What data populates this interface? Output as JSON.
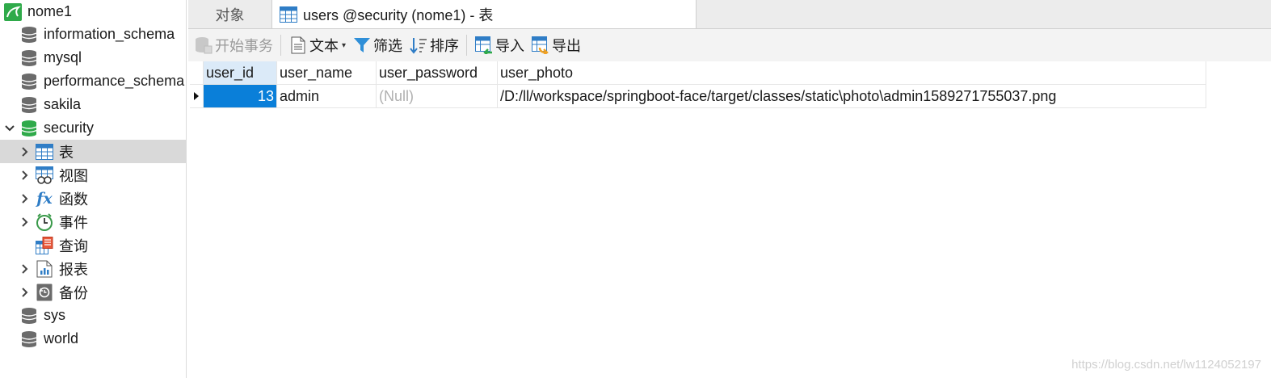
{
  "sidebar": {
    "connection": "nome1",
    "items": [
      {
        "label": "information_schema",
        "icon": "database-icon"
      },
      {
        "label": "mysql",
        "icon": "database-icon"
      },
      {
        "label": "performance_schema",
        "icon": "database-icon"
      },
      {
        "label": "sakila",
        "icon": "database-icon"
      },
      {
        "label": "security",
        "icon": "database-open-icon"
      },
      {
        "label": "表",
        "icon": "table-icon"
      },
      {
        "label": "视图",
        "icon": "view-icon"
      },
      {
        "label": "函数",
        "icon": "function-icon"
      },
      {
        "label": "事件",
        "icon": "event-icon"
      },
      {
        "label": "查询",
        "icon": "query-icon"
      },
      {
        "label": "报表",
        "icon": "report-icon"
      },
      {
        "label": "备份",
        "icon": "backup-icon"
      },
      {
        "label": "sys",
        "icon": "database-icon"
      },
      {
        "label": "world",
        "icon": "database-icon"
      }
    ]
  },
  "tabs": {
    "objects": "对象",
    "active": "users @security (nome1) - 表"
  },
  "toolbar": {
    "begin_transaction": "开始事务",
    "text": "文本",
    "filter": "筛选",
    "sort": "排序",
    "import": "导入",
    "export": "导出"
  },
  "grid": {
    "columns": [
      "user_id",
      "user_name",
      "user_password",
      "user_photo"
    ],
    "rows": [
      [
        "13",
        "admin",
        "(Null)",
        "/D:/ll/workspace/springboot-face/target/classes/static\\photo\\admin1589271755037.png"
      ]
    ]
  },
  "watermark": "https://blog.csdn.net/lw1124052197",
  "colors": {
    "selected_cell": "#0a7fd9",
    "header_selected": "#dbeaf8",
    "sidebar_selected": "#d9d9d9",
    "connection_green": "#2faa4a"
  }
}
